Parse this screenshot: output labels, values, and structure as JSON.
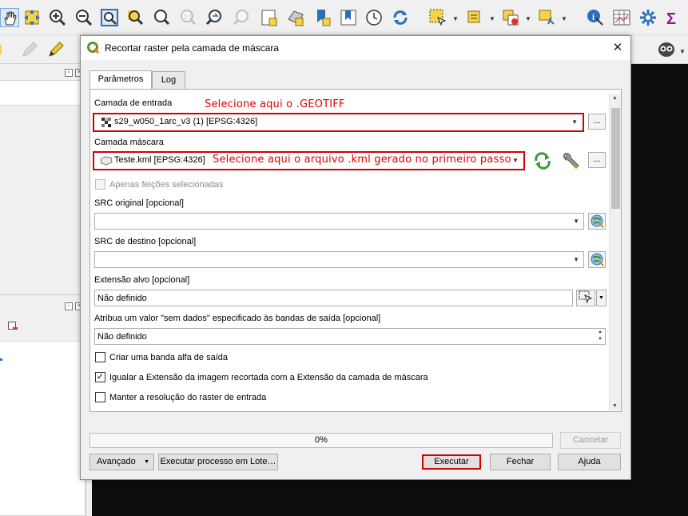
{
  "dialog": {
    "title": "Recortar raster pela camada de máscara",
    "close_symbol": "✕"
  },
  "tabs": [
    {
      "label": "Parâmetros",
      "active": true
    },
    {
      "label": "Log",
      "active": false
    }
  ],
  "params": {
    "input_layer": {
      "label": "Camada de entrada",
      "value": "s29_w050_1arc_v3 (1) [EPSG:4326]",
      "browse_label": "..."
    },
    "mask_layer": {
      "label": "Camada máscara",
      "value": "Teste.kml [EPSG:4326]",
      "browse_label": "..."
    },
    "selected_only": {
      "label": "Apenas feições selecionadas",
      "checked": false,
      "enabled": false
    },
    "source_crs": {
      "label": "SRC original [opcional]",
      "value": ""
    },
    "target_crs": {
      "label": "SRC de destino [opcional]",
      "value": ""
    },
    "target_extent": {
      "label": "Extensão alvo [opcional]",
      "value": "Não definido"
    },
    "nodata": {
      "label": "Atribua um valor \"sem dados\" especificado às bandas de saída [opcional]",
      "value": "Não definido"
    },
    "alpha_band": {
      "label": "Criar uma banda alfa de saída",
      "checked": false
    },
    "crop_to_cutline": {
      "label": "Igualar a Extensão da imagem recortada com a Extensão da camada de máscara",
      "checked": true
    },
    "keep_resolution": {
      "label": "Manter a resolução do raster de entrada",
      "checked": false
    }
  },
  "annotations": {
    "input": "Selecione aqui o .GEOTIFF",
    "mask": "Selecione aqui o arquivo .kml gerado no primeiro passo",
    "color": "#e00000"
  },
  "progress": {
    "value": 0,
    "text": "0%"
  },
  "buttons": {
    "cancel": "Cancelar",
    "advanced": "Avançado",
    "batch": "Executar processo em Lote…",
    "run": "Executar",
    "close": "Fechar",
    "help": "Ajuda"
  },
  "toolbar_icons": [
    "pan-hand-icon",
    "pan-to-selection-icon",
    "zoom-in-icon",
    "zoom-out-icon",
    "zoom-full-icon",
    "zoom-to-selection-icon",
    "zoom-to-layer-icon",
    "zoom-native-icon",
    "zoom-last-icon",
    "zoom-next-icon",
    "new-map-view-icon",
    "new-3d-view-icon",
    "new-bookmark-icon",
    "show-bookmarks-icon",
    "temporal-controller-icon",
    "refresh-icon",
    "select-features-icon",
    "select-by-value-icon",
    "deselect-icon",
    "select-location-icon",
    "identify-icon",
    "attribute-table-icon",
    "processing-toolbox-icon",
    "statistics-sum-icon"
  ]
}
